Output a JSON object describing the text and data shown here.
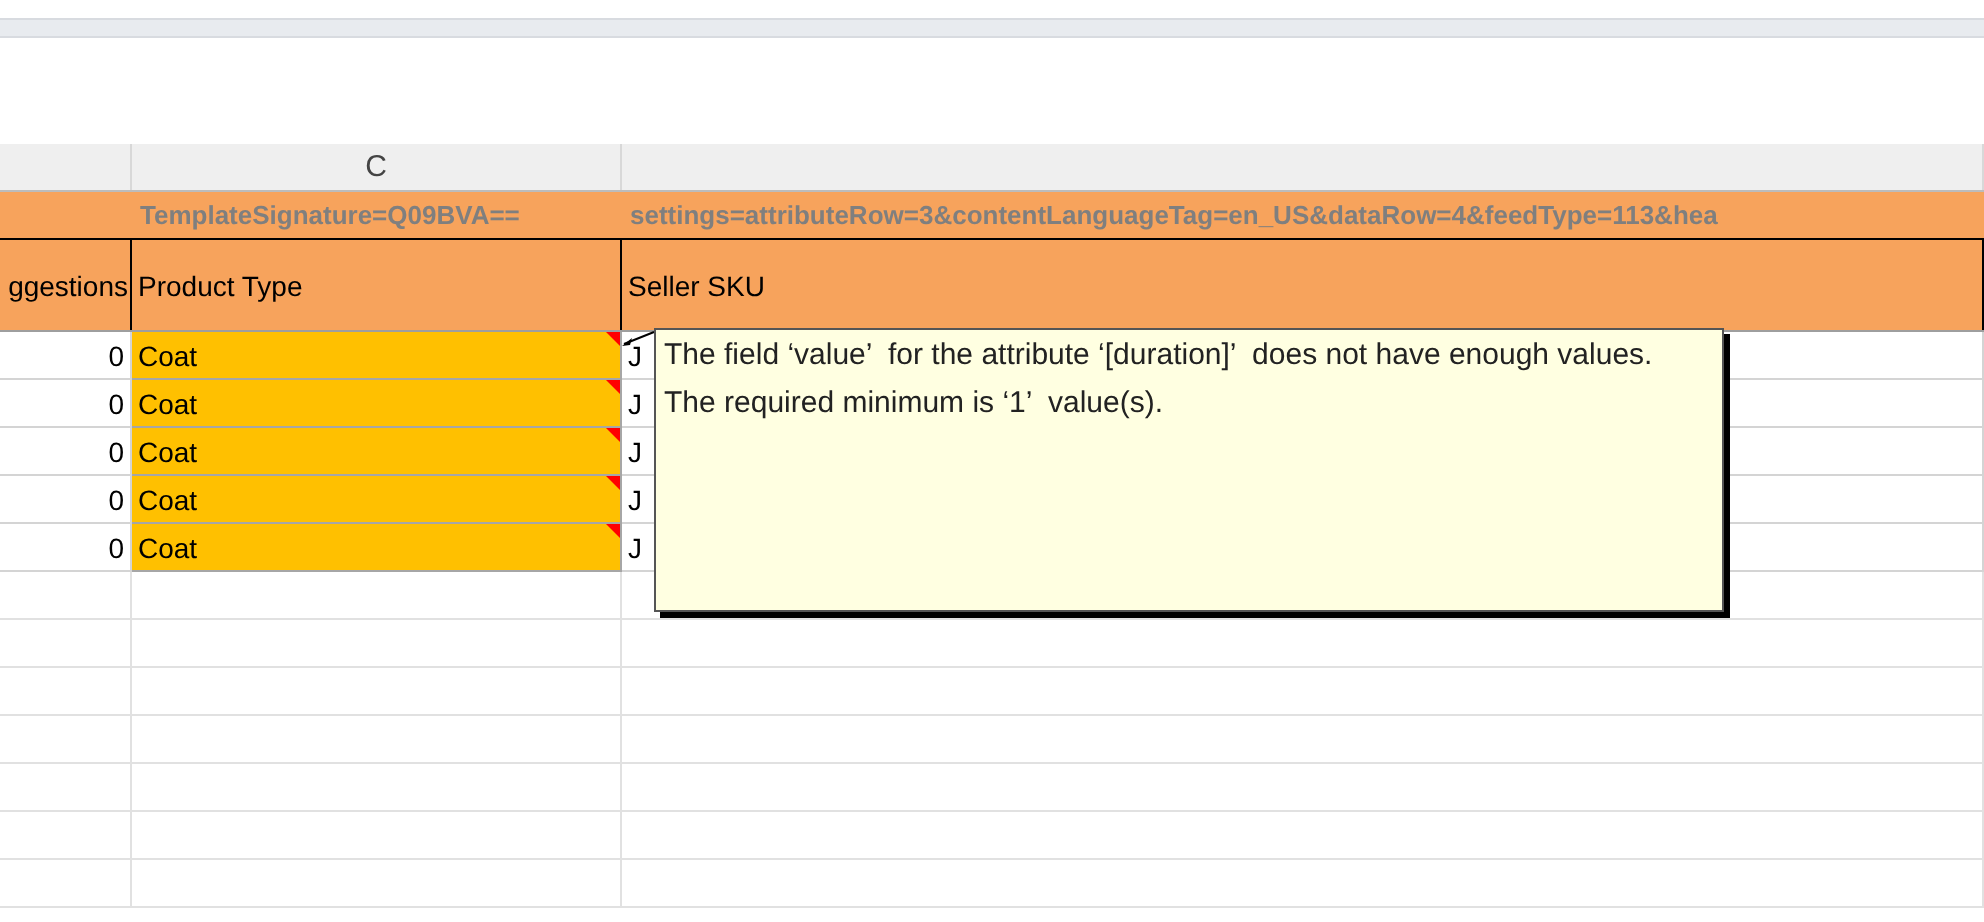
{
  "column_header": "C",
  "template_row": [
    "TemplateSignature=Q09BVA==",
    "settings=attributeRow=3&contentLanguageTag=en_US&dataRow=4&feedType=113&hea"
  ],
  "header_row": [
    "ggestions",
    "Product Type",
    "Seller SKU"
  ],
  "rows": [
    {
      "suggestions": "0",
      "product_type": "Coat",
      "seller_sku": "J",
      "flagged": true,
      "has_comment": true
    },
    {
      "suggestions": "0",
      "product_type": "Coat",
      "seller_sku": "J",
      "flagged": true,
      "has_comment": true
    },
    {
      "suggestions": "0",
      "product_type": "Coat",
      "seller_sku": "J",
      "flagged": true,
      "has_comment": true
    },
    {
      "suggestions": "0",
      "product_type": "Coat",
      "seller_sku": "J",
      "flagged": true,
      "has_comment": true
    },
    {
      "suggestions": "0",
      "product_type": "Coat",
      "seller_sku": "J",
      "flagged": true,
      "has_comment": true
    }
  ],
  "comment": {
    "text": "The field ‘value’  for the attribute ‘[duration]’  does not have enough values. The required minimum is ‘1’  value(s)."
  }
}
